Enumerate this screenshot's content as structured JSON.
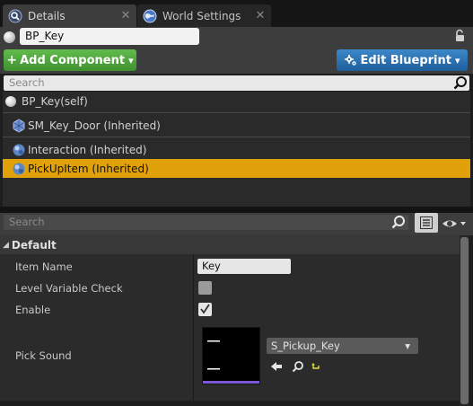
{
  "tabs": [
    {
      "label": "Details",
      "active": true,
      "close": "✕"
    },
    {
      "label": "World Settings",
      "active": false,
      "close": "✕"
    }
  ],
  "actor": {
    "name": "BP_Key"
  },
  "buttons": {
    "add_component": {
      "icon": "+",
      "label": "Add Component",
      "caret": "▾"
    },
    "edit_blueprint": {
      "icon": "gear-icon",
      "label": "Edit Blueprint",
      "caret": "▾"
    }
  },
  "components_search": {
    "placeholder": "Search"
  },
  "components": [
    {
      "label": "BP_Key(self)",
      "icon": "sphere-icon"
    },
    {
      "label": "SM_Key_Door (Inherited)",
      "icon": "static-mesh-icon"
    },
    {
      "label": "Interaction (Inherited)",
      "icon": "actor-component-icon"
    },
    {
      "label": "PickUpItem (Inherited)",
      "icon": "actor-component-icon",
      "selected": true
    }
  ],
  "details_search": {
    "placeholder": "Search"
  },
  "category": {
    "label": "Default",
    "arrow": "◢"
  },
  "properties": {
    "item_name": {
      "label": "Item Name",
      "value": "Key"
    },
    "level_variable_check": {
      "label": "Level Variable Check",
      "checked": false
    },
    "enable": {
      "label": "Enable",
      "checked": true
    },
    "pick_sound": {
      "label": "Pick Sound",
      "asset": "S_Pickup_Key",
      "caret": "▾"
    }
  },
  "colors": {
    "selection": "#e0a10a",
    "add_button": "#4fa83c",
    "edit_button": "#2a6fb0",
    "sound_asset_bar": "#7b57d6"
  }
}
